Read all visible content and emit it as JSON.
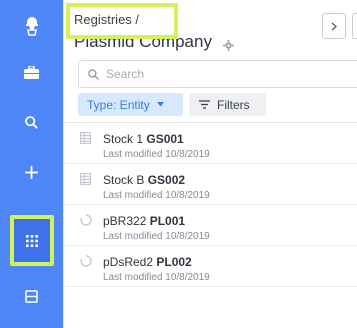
{
  "sidebar": {
    "items": [
      {
        "name": "logo-icon"
      },
      {
        "name": "briefcase-icon"
      },
      {
        "name": "search-icon"
      },
      {
        "name": "plus-icon"
      },
      {
        "name": "grid-icon",
        "active": true
      },
      {
        "name": "layout-icon"
      }
    ],
    "accent": "#4f86f7",
    "highlight": "#d4f25a"
  },
  "header": {
    "breadcrumb": "Registries /",
    "title": "Plasmid Company"
  },
  "search": {
    "placeholder": "Search"
  },
  "filters": {
    "type_label": "Type: Entity",
    "filters_label": "Filters"
  },
  "rows": [
    {
      "icon": "table-icon",
      "name": "Stock 1",
      "id": "GS001",
      "modified": "Last modified 10/8/2019"
    },
    {
      "icon": "table-icon",
      "name": "Stock B",
      "id": "GS002",
      "modified": "Last modified 10/8/2019"
    },
    {
      "icon": "plasmid-icon",
      "name": "pBR322",
      "id": "PL001",
      "modified": "Last modified 10/8/2019"
    },
    {
      "icon": "plasmid-icon",
      "name": "pDsRed2",
      "id": "PL002",
      "modified": "Last modified 10/8/2019"
    }
  ]
}
